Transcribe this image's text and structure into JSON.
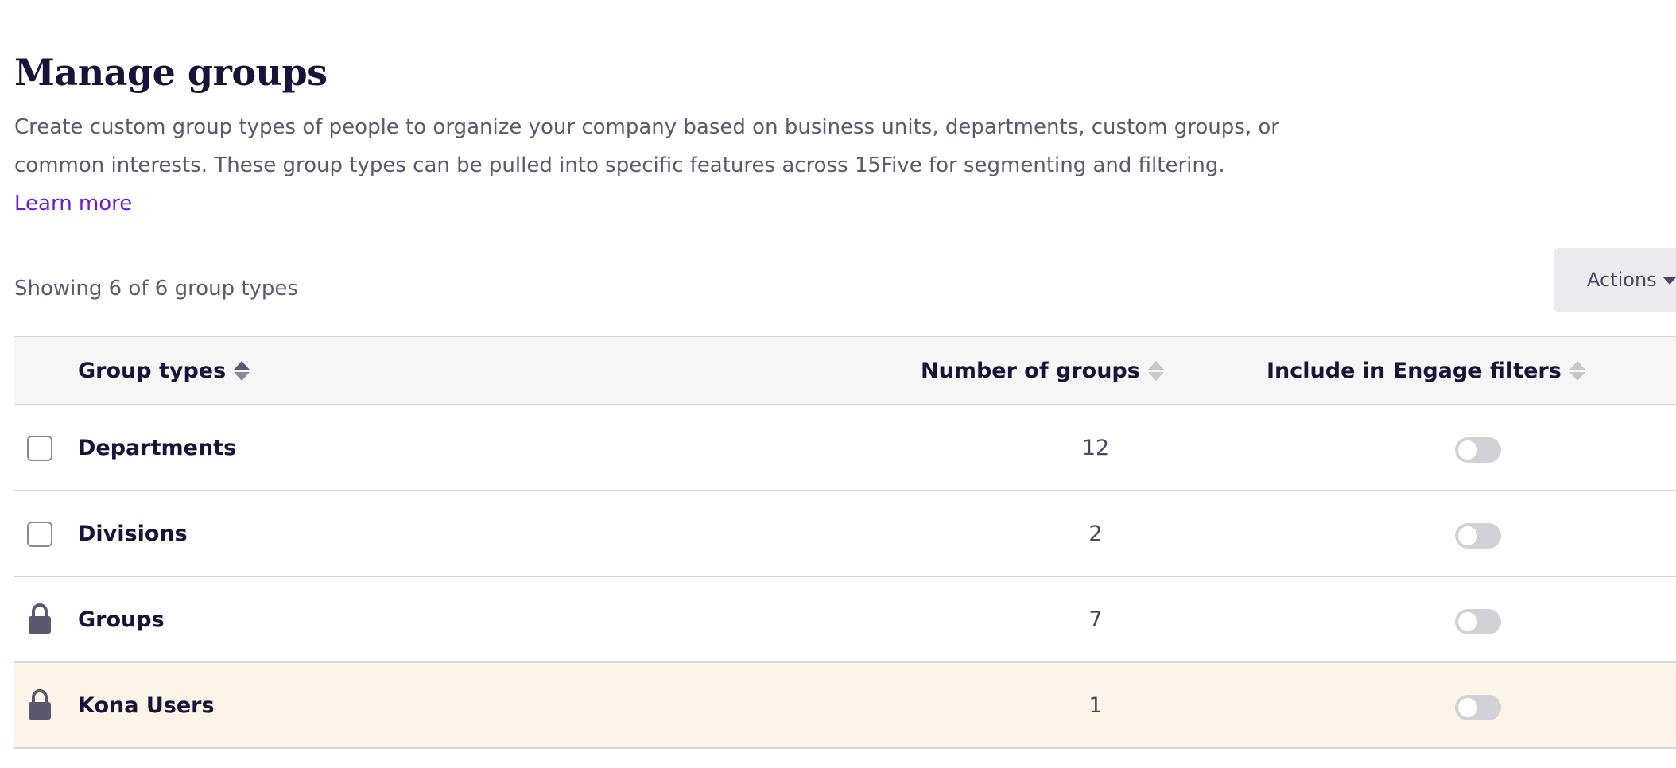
{
  "page": {
    "title": "Manage groups",
    "description": "Create custom group types of people to organize your company based on business units, departments, custom groups, or common interests. These group types can be pulled into specific features across 15Five for segmenting and filtering.",
    "learn_more": "Learn more"
  },
  "toolbar": {
    "showing": "Showing 6 of 6 group types",
    "actions_label": "Actions"
  },
  "table": {
    "headers": {
      "group_types": "Group types",
      "number_of_groups": "Number of groups",
      "include_engage": "Include in Engage filters"
    },
    "rows": [
      {
        "name": "Departments",
        "count": "12",
        "selector": "checkbox",
        "engage_enabled": false,
        "highlighted": false
      },
      {
        "name": "Divisions",
        "count": "2",
        "selector": "checkbox",
        "engage_enabled": false,
        "highlighted": false
      },
      {
        "name": "Groups",
        "count": "7",
        "selector": "lock-icon",
        "engage_enabled": false,
        "highlighted": false
      },
      {
        "name": "Kona Users",
        "count": "1",
        "selector": "lock-icon",
        "engage_enabled": false,
        "highlighted": true
      }
    ]
  },
  "colors": {
    "accent_link": "#6a1ad9",
    "heading": "#17143a",
    "highlight_row": "#fdf4e8",
    "toggle_off": "#d2d1d8"
  }
}
